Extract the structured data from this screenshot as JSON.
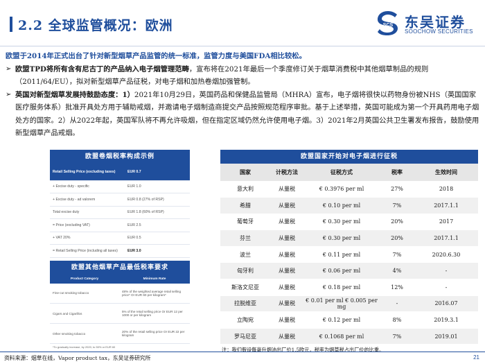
{
  "header": {
    "title": "2.2 全球监管概况：欧洲",
    "logo_cn": "东吴证券",
    "logo_en": "SOOCHOW SECURITIES",
    "logo_mark_text": "SCS"
  },
  "body": {
    "lead": "欧盟于2014年正式出台了针对新型烟草产品监管的统一标准，监管力度与美国FDA相比较松。",
    "bullet1_bold": "欧盟TPD将所有含有尼古丁的产品纳入电子烟管理范畴",
    "bullet1_text": "，宣布将在2021年最后一个季度修订关于烟草消费税中其他烟草制品的规则（2011/64/EU），拟对新型烟草产品征税，对电子烟和加热卷烟加强管制。",
    "bullet2_bold": "英国对新型烟草发展持鼓励态度：1）",
    "bullet2_text": "2021年10月29日，英国药品和保健品监管局（MHRA）宣布，电子烟将很快以药物身份被NHS（英国国家医疗服务体系）批准开具处方用于辅助戒烟，并邀请电子烟制造商提交产品按照规范程序审批。基于上述举措，英国可能成为第一个开具药用电子烟处方的国家。2）从2022年起，英国军队将不再允许吸烟，但在指定区域仍然允许使用电子烟。3）2021年2月英国公共卫生署发布报告，鼓励使用新型烟草产品戒烟。"
  },
  "tax_panel": {
    "title": "欧盟卷烟税率构成示例",
    "rows": [
      {
        "label": "Retail Selling Price (excluding taxes)",
        "value": "EUR 0.7"
      },
      {
        "label": "+ Excise duty - specific",
        "value": "EUR 1.0"
      },
      {
        "label": "+ Excise duty - ad valorem",
        "value": "EUR 0.8 (27% of RSP)"
      },
      {
        "label": "Total excise duty",
        "value": "EUR 1.8 (60% of RSP)"
      },
      {
        "label": "= Price (excluding VAT)",
        "value": "EUR 2.5"
      },
      {
        "label": "+ VAT 20%",
        "value": "EUR 0.5"
      },
      {
        "label": "= Retail Selling Price (including all taxes)",
        "value": "EUR 3.0"
      }
    ]
  },
  "min_panel": {
    "title": "欧盟其他烟草产品最低税率要求",
    "headers": [
      "Product Category",
      "Minimum Rate"
    ],
    "rows": [
      {
        "category": "Fine-cut smoking tobacco",
        "rate": "48% of the weighted average retail selling price* Or EUR 60 per kilogram*"
      },
      {
        "category": "Cigars and Cigarillos",
        "rate": "5% of the retail selling price Or EUR 12 per 1000 or per kilogram"
      },
      {
        "category": "Other smoking tobacco",
        "rate": "20% of the retail selling price Or EUR 22 per kilogram"
      }
    ],
    "footnote": "*To gradually increase, by 2020, to 50% or EUR 60"
  },
  "ex_panel": {
    "title": "欧盟国家开始对电子烟进行征税",
    "headers": [
      "国家",
      "计税方法",
      "征税方式",
      "税率",
      "生效时间"
    ],
    "rows": [
      {
        "country": "意大利",
        "method": "从量税",
        "tax": "€ 0.3976 per ml",
        "rate": "27%",
        "date": "2018"
      },
      {
        "country": "希腊",
        "method": "从量税",
        "tax": "€ 0.10 per ml",
        "rate": "7%",
        "date": "2017.1.1"
      },
      {
        "country": "葡萄牙",
        "method": "从量税",
        "tax": "€ 0.30 per ml",
        "rate": "20%",
        "date": "2017"
      },
      {
        "country": "芬兰",
        "method": "从量税",
        "tax": "€ 0.30 per ml",
        "rate": "20%",
        "date": "2017.1.1"
      },
      {
        "country": "波兰",
        "method": "从量税",
        "tax": "€ 0.11 per ml",
        "rate": "7%",
        "date": "2020.6.30"
      },
      {
        "country": "匈牙利",
        "method": "从量税",
        "tax": "€ 0.06 per ml",
        "rate": "4%",
        "date": "-"
      },
      {
        "country": "斯洛文尼亚",
        "method": "从量税",
        "tax": "€ 0.18 per ml",
        "rate": "12%",
        "date": "-"
      },
      {
        "country": "拉脱维亚",
        "method": "从量税",
        "tax": "€ 0.01 per ml € 0.005 per mg",
        "rate": "-",
        "date": "2016.07"
      },
      {
        "country": "立陶宛",
        "method": "从量税",
        "tax": "€ 0.12 per ml",
        "rate": "8%",
        "date": "2019.3.1"
      },
      {
        "country": "罗马尼亚",
        "method": "从量税",
        "tax": "€ 0.1068 per ml",
        "rate": "7%",
        "date": "2019.01"
      }
    ],
    "note": "注：我们假设每毫升烟油出厂价1.5欧元，税率为烟草税占出厂价的比重。"
  },
  "footer": {
    "source": "资料来源：烟草在线，Vapor product tax，东吴证券研究所",
    "page": "21"
  },
  "colors": {
    "brand_blue": "#1f4e9c",
    "header_gray": "#e6e6e6"
  }
}
